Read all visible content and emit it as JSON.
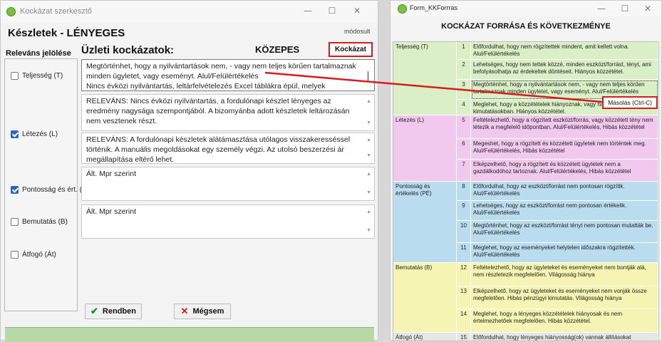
{
  "left_window": {
    "title": "Kockázat szerkesztő",
    "heading": "Készletek - LÉNYEGES",
    "status": "módosult",
    "relevans_label": "Releváns jelölése",
    "uzleti_label": "Üzleti kockázatok:",
    "level_label": "KÖZEPES",
    "kockazat_button": "Kockázat",
    "checkboxes": [
      {
        "label": "Teljesség (T)",
        "checked": false
      },
      {
        "label": "Létezés (L)",
        "checked": true
      },
      {
        "label": "Pontosság és ért. (PÉ",
        "checked": true
      },
      {
        "label": "Bemutatás (B)",
        "checked": false
      },
      {
        "label": "Átfogó (Át)",
        "checked": false
      }
    ],
    "textboxes": [
      "Megtörténhet, hogy a nyilvántartások nem, - vagy nem teljes körűen tartalmaznak minden ügyletet, vagy eseményt. Alul/Felülértékelés\nNincs évközi nyilvántartás, leltárfelvételezés Excel táblákra épül, melyek",
      "RELEVÁNS: Nincs évközi nyilvántartás, a fordulónapi készlet lényeges az eredmény nagysága szempontjából. A bizomyánba adott készletek leltározásán nem vesztenek részt.",
      "RELEVÁNS: A fordulónapi készletek alátámasztása utólagos visszakeresséssel történik. A manuális megoldásokat egy személy végzi. Az utolsó beszerzési ár megállapítása eltérő lehet.",
      "Ált. Mpr szerint",
      "Ált. Mpr szerint"
    ],
    "ok_button": "Rendben",
    "cancel_button": "Mégsem"
  },
  "right_window": {
    "title": "Form_KKForrras",
    "header": "KOCKÁZAT FORRÁSA ÉS KÖVETKEZMÉNYE",
    "context_menu_item": "Másolás (Ctrl-C)",
    "colors": {
      "teljesseg": "#d9efc6",
      "letezes": "#f1c9ef",
      "pontossag": "#b9dcef",
      "bemutatas": "#f6f4b3"
    },
    "rows": [
      {
        "category": "Teljesség (T)",
        "num": "1",
        "text": "Előfordulhat, hogy nem rögzítettek mindent, amit kellett volna. Alul/Felülértékelés"
      },
      {
        "category": "",
        "num": "2",
        "text": "Lehetséges, hogy nem tettek közzé, minden eszközt/forrást, tényt, ami befolyásolhatja az érdekeltek döntéseit. Hiányos közzététel."
      },
      {
        "category": "",
        "num": "3",
        "text": "Megtörténhet, hogy a nyilvántartások nem, - vagy nem teljes körűen tartalmaznak minden ügyletet, vagy eseményt. Alul/Felülértékelés"
      },
      {
        "category": "",
        "num": "4",
        "text": "Meglehet, hogy a közzétételek hiányoznak, vagy hiányosak a pénzügyi kimutatásokban. Hiányos közzététel."
      },
      {
        "category": "Létezés (L)",
        "num": "5",
        "text": "Feltételezhető, hogy a rögzített eszközt/forrás, vagy közzétett tény nem létezik a megfelelő időpontban. Alul/Felülértékelés, Hibás közzététel"
      },
      {
        "category": "",
        "num": "6",
        "text": "Megeshet, hogy a rögzített és közzétett ügyletek nem történtek meg. Alul/Felülértékelés, Hibás közzététel"
      },
      {
        "category": "",
        "num": "7",
        "text": "Elképzelhető, hogy a rögzített és közzétett ügyletek nem a gazdálkodóhoz tartoznak. Alul/Felülértékelés, Hibás közzététel"
      },
      {
        "category": "Pontosság és értékelés (PÉ)",
        "num": "8",
        "text": "Előfordulhat, hogy az eszközt/forrást nem pontosan rögzítik. Alul/Felülértékelés"
      },
      {
        "category": "",
        "num": "9",
        "text": "Lehetséges, hogy az eszközt/forrást nem pontosan értékelik. Alul/Felülértékelés"
      },
      {
        "category": "",
        "num": "10",
        "text": "Megtörténhet, hogy az eszközt/forrást tényt nem pontosan mutatták be. Alul/Felülértékelés"
      },
      {
        "category": "",
        "num": "11",
        "text": "Meglehet, hogy az eseményeket helytelen időszakra rögzítették. Alul/Felülértékelés"
      },
      {
        "category": "Bemutatás (B)",
        "num": "12",
        "text": "Feltételezhető, hogy az ügyleteket és eseményeket nem bontják alá, nem részletezik megfelelően. Világosság hiánya"
      },
      {
        "category": "",
        "num": "13",
        "text": "Elképzelhető, hogy az ügyleteket és eseményeket nem vonják össze megfelelően. Hibás pénzügyi kimutatás. Világosság hiánya"
      },
      {
        "category": "",
        "num": "14",
        "text": "Meglehet, hogy a lényeges közzétételek hiányosak és nem értelmezhetőek megfelelően. Hibás közzététel."
      },
      {
        "category": "Átfogó (Át)",
        "num": "15",
        "text": "Előfordulhat, hogy lényeges hiányosság(ok) vannak állításokat"
      }
    ]
  }
}
